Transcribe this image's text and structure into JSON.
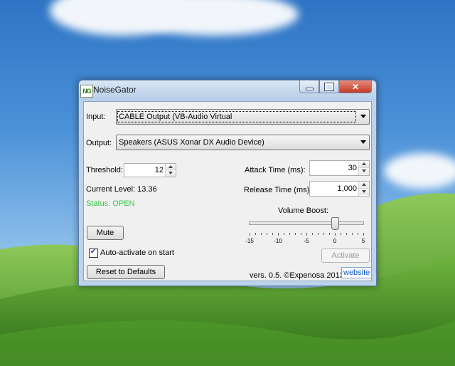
{
  "window": {
    "title": "NoiseGator",
    "icon_text": "NG"
  },
  "input": {
    "label": "Input:",
    "value": "CABLE Output (VB-Audio Virtual"
  },
  "output": {
    "label": "Output:",
    "value": "Speakers (ASUS Xonar DX Audio Device)"
  },
  "threshold": {
    "label": "Threshold:",
    "value": "12"
  },
  "current_level": {
    "label": "Current Level: 13.36"
  },
  "status": {
    "text": "Status: OPEN",
    "color": "#2ecc40"
  },
  "attack": {
    "label": "Attack Time (ms):",
    "value": "30"
  },
  "release": {
    "label": "Release Time (ms):",
    "value": "1,000"
  },
  "volume_boost": {
    "label": "Volume Boost:",
    "min": -15,
    "max": 5,
    "value": 0,
    "tick_labels": [
      "-15",
      "-10",
      "-5",
      "0",
      "5"
    ]
  },
  "buttons": {
    "mute": "Mute",
    "reset": "Reset to Defaults",
    "activate": "Activate"
  },
  "auto_activate": {
    "label": "Auto-activate on start",
    "checked": true
  },
  "footer": {
    "version": "vers. 0.5. ©Expenosa 2013.",
    "website": "website"
  }
}
